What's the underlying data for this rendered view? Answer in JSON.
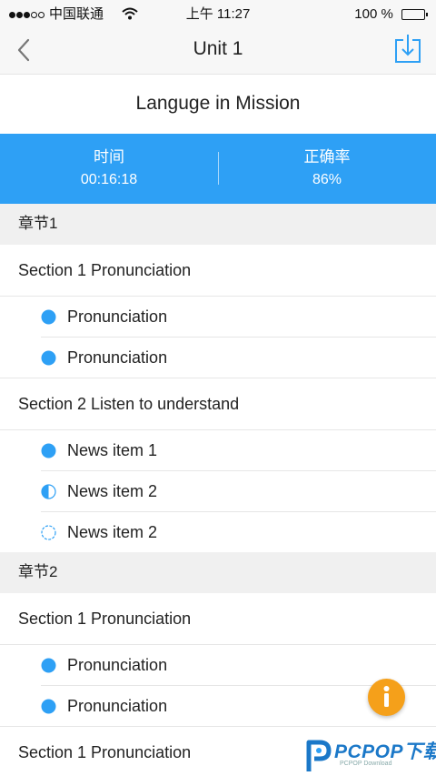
{
  "status_bar": {
    "carrier": "中国联通",
    "time": "上午 11:27",
    "battery": "100 %"
  },
  "nav": {
    "title": "Unit 1",
    "back_icon": "chevron-left-icon",
    "download_icon": "download-icon"
  },
  "subtitle": "Languge in Mission",
  "stats": {
    "time_label": "时间",
    "time_value": "00:16:18",
    "accuracy_label": "正确率",
    "accuracy_value": "86%"
  },
  "chapters": [
    {
      "title": "章节1",
      "sections": [
        {
          "title": "Section 1 Pronunciation",
          "items": [
            {
              "label": "Pronunciation",
              "progress": "full"
            },
            {
              "label": "Pronunciation",
              "progress": "full"
            }
          ]
        },
        {
          "title": "Section 2 Listen to understand",
          "items": [
            {
              "label": "News item 1",
              "progress": "full"
            },
            {
              "label": "News item 2",
              "progress": "half"
            },
            {
              "label": "News item 2",
              "progress": "empty"
            }
          ]
        }
      ]
    },
    {
      "title": "章节2",
      "sections": [
        {
          "title": "Section 1 Pronunciation",
          "items": [
            {
              "label": "Pronunciation",
              "progress": "full"
            },
            {
              "label": "Pronunciation",
              "progress": "full"
            }
          ]
        },
        {
          "title": "Section 1 Pronunciation",
          "items": []
        }
      ]
    }
  ],
  "fab_icon": "info-icon",
  "watermark": {
    "text": "PCPOP下载",
    "subtext": "PCPOP Download"
  },
  "colors": {
    "accent": "#2ea0f5",
    "fab": "#f5a01a",
    "chapter_bg": "#f0f0f0"
  }
}
